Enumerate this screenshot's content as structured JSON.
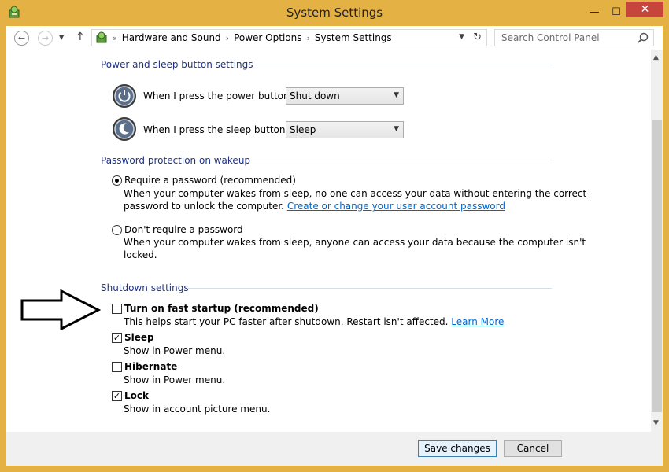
{
  "window": {
    "title": "System Settings",
    "minimize_glyph": "—",
    "maximize_glyph": "☐",
    "close_glyph": "✕"
  },
  "nav": {
    "back_glyph": "←",
    "forward_glyph": "→",
    "recent_glyph": "▼",
    "up_glyph": "↑",
    "breadcrumb_prefix": "«",
    "breadcrumbs": [
      "Hardware and Sound",
      "Power Options",
      "System Settings"
    ],
    "crumb_separator": "›",
    "dropdown_glyph": "▼",
    "refresh_glyph": "↻",
    "search_placeholder": "Search Control Panel"
  },
  "power_section": {
    "heading": "Power and sleep button settings",
    "power_button_label": "When I press the power button:",
    "power_button_value": "Shut down",
    "sleep_button_label": "When I press the sleep button:",
    "sleep_button_value": "Sleep",
    "select_arrow": "▼"
  },
  "password_section": {
    "heading": "Password protection on wakeup",
    "require": {
      "label": "Require a password (recommended)",
      "selected": true,
      "desc_line1": "When your computer wakes from sleep, no one can access your data without entering the correct",
      "desc_line2": "password to unlock the computer.",
      "link": "Create or change your user account password"
    },
    "no_require": {
      "label": "Don't require a password",
      "selected": false,
      "desc_line1": "When your computer wakes from sleep, anyone can access your data because the computer isn't",
      "desc_line2": "locked."
    }
  },
  "shutdown_section": {
    "heading": "Shutdown settings",
    "check_glyph": "✓",
    "fast_startup": {
      "label": "Turn on fast startup (recommended)",
      "checked": false,
      "desc": "This helps start your PC faster after shutdown. Restart isn't affected.",
      "link": "Learn More"
    },
    "sleep": {
      "label": "Sleep",
      "checked": true,
      "desc": "Show in Power menu."
    },
    "hibernate": {
      "label": "Hibernate",
      "checked": false,
      "desc": "Show in Power menu."
    },
    "lock": {
      "label": "Lock",
      "checked": true,
      "desc": "Show in account picture menu."
    }
  },
  "scrollbar": {
    "up_glyph": "▲",
    "down_glyph": "▼"
  },
  "footer": {
    "save_label": "Save changes",
    "cancel_label": "Cancel"
  }
}
